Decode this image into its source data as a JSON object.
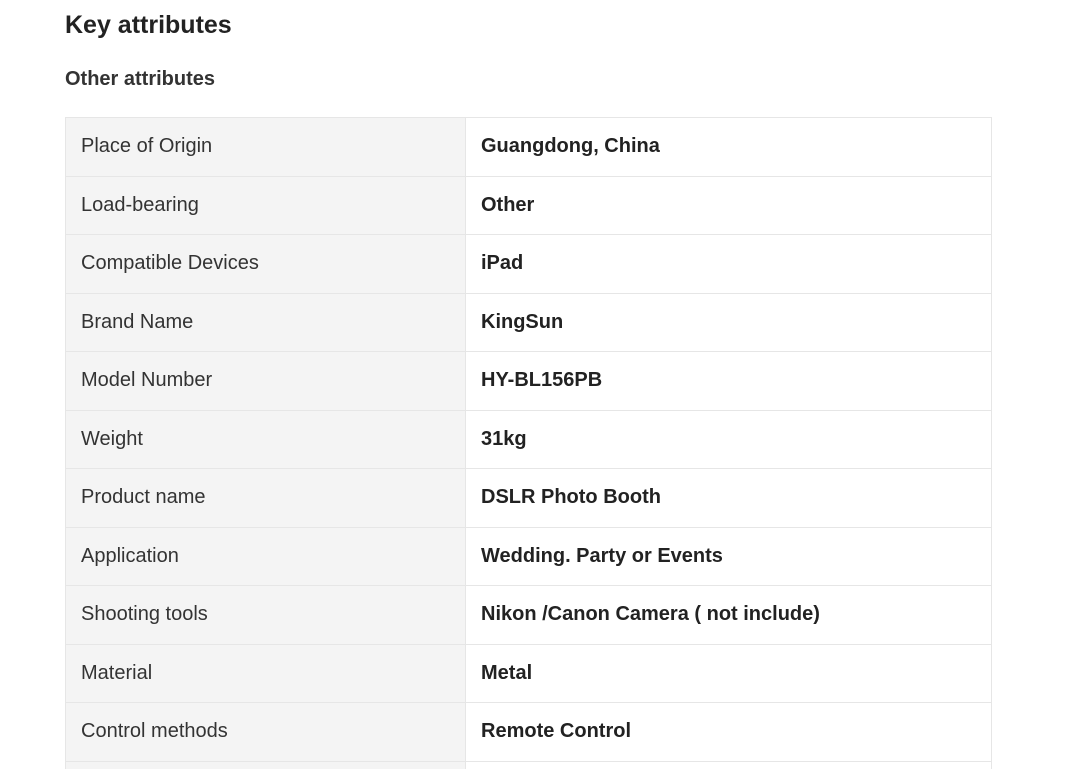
{
  "section": {
    "title": "Key attributes",
    "subtitle": "Other attributes"
  },
  "attributes": [
    {
      "label": "Place of Origin",
      "value": "Guangdong, China"
    },
    {
      "label": "Load-bearing",
      "value": "Other"
    },
    {
      "label": "Compatible Devices",
      "value": "iPad"
    },
    {
      "label": "Brand Name",
      "value": "KingSun"
    },
    {
      "label": "Model Number",
      "value": "HY-BL156PB"
    },
    {
      "label": "Weight",
      "value": "31kg"
    },
    {
      "label": "Product name",
      "value": "DSLR Photo Booth"
    },
    {
      "label": "Application",
      "value": "Wedding. Party or Events"
    },
    {
      "label": "Shooting tools",
      "value": "Nikon /Canon Camera ( not include)"
    },
    {
      "label": "Material",
      "value": "Metal"
    },
    {
      "label": "Control methods",
      "value": "Remote Control"
    }
  ]
}
